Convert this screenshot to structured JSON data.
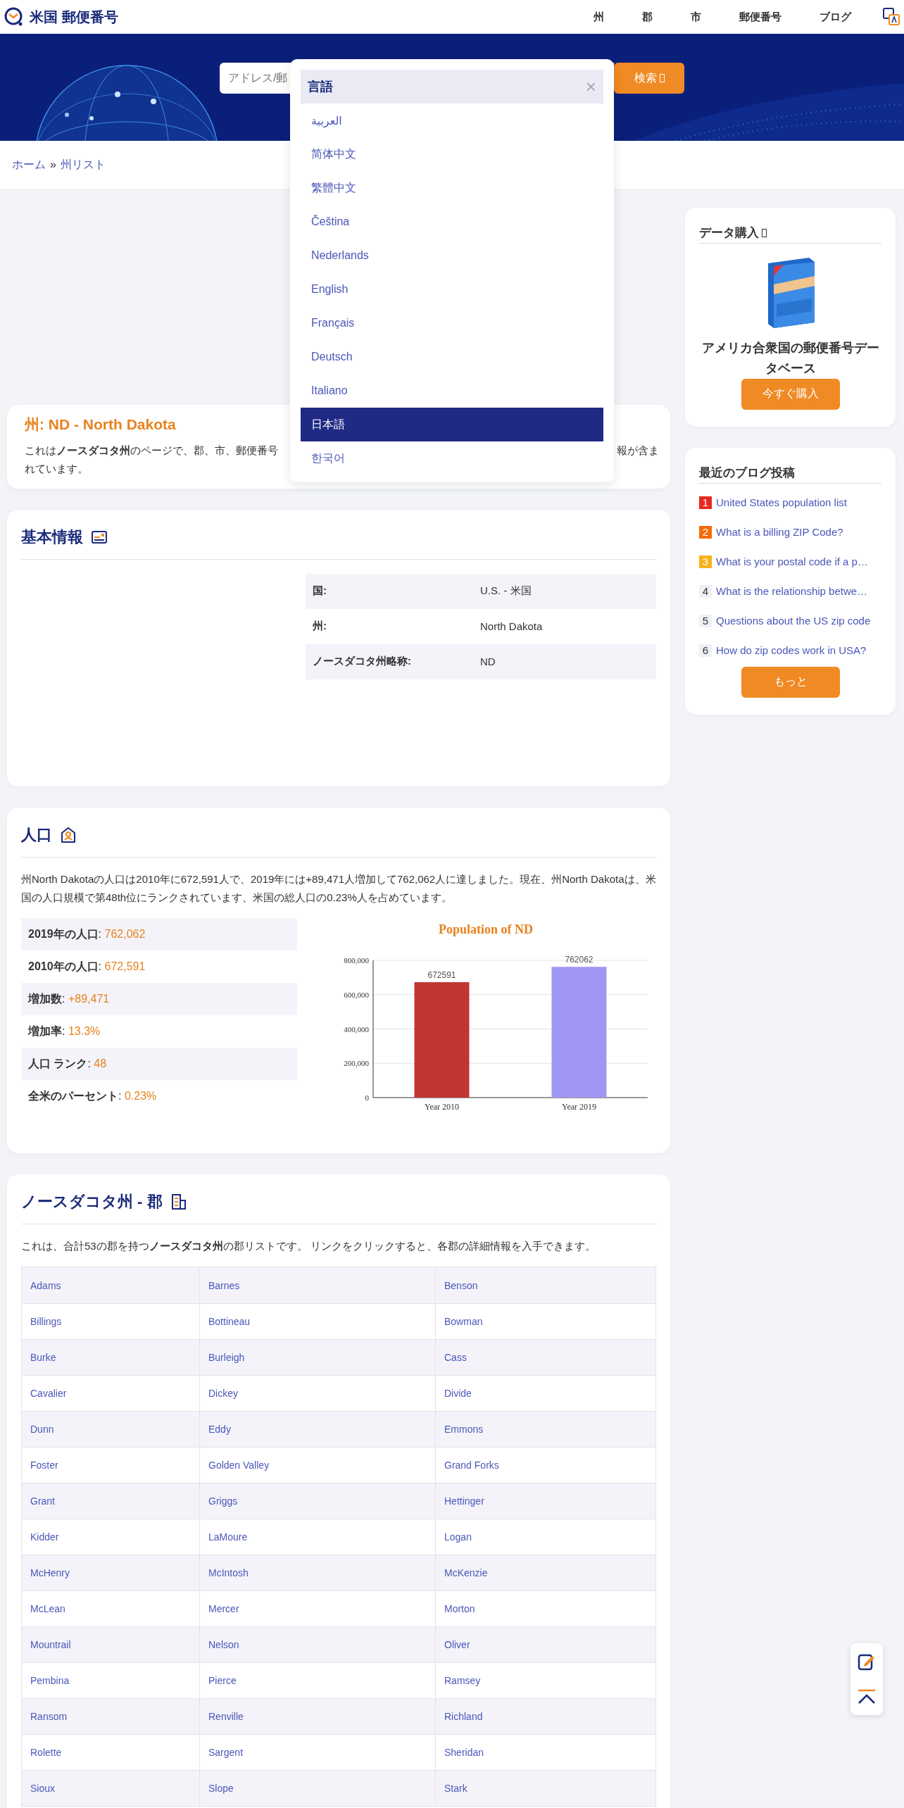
{
  "header": {
    "logo": "米国 郵便番号",
    "nav": [
      "州",
      "郡",
      "市",
      "郵便番号",
      "ブログ"
    ]
  },
  "search": {
    "placeholder": "アドレス/郵",
    "button": "検索"
  },
  "language_menu": {
    "title": "言語",
    "close": "×",
    "items": [
      {
        "label": "العربية",
        "selected": false
      },
      {
        "label": "简体中文",
        "selected": false
      },
      {
        "label": "繁體中文",
        "selected": false
      },
      {
        "label": "Čeština",
        "selected": false
      },
      {
        "label": "Nederlands",
        "selected": false
      },
      {
        "label": "English",
        "selected": false
      },
      {
        "label": "Français",
        "selected": false
      },
      {
        "label": "Deutsch",
        "selected": false
      },
      {
        "label": "Italiano",
        "selected": false
      },
      {
        "label": "日本語",
        "selected": true
      },
      {
        "label": "한국어",
        "selected": false
      }
    ]
  },
  "breadcrumb": [
    "ホーム",
    "»",
    "州リスト"
  ],
  "state_card": {
    "title": "州: ND - North Dakota",
    "intro_start": "これは**ノースダコタ州**のページで、郡、市、郵便番号",
    "intro_end_1": "報が含ま",
    "intro_end_2": "れています。"
  },
  "basic_info": {
    "title": "基本情報",
    "rows": [
      {
        "label": "国:",
        "value": "U.S. - 米国"
      },
      {
        "label": "州:",
        "value": "North Dakota"
      },
      {
        "label": "ノースダコタ州略称:",
        "value": "ND"
      }
    ]
  },
  "population": {
    "title": "人口",
    "text": "州North Dakotaの人口は2010年に672,591人で、2019年には+89,471人増加して762,062人に達しました。現在、州North Dakotaは、米国の人口規模で第48th位にランクされています、米国の総人口の0.23%人を占めています。",
    "stats": [
      {
        "label": "2019年の人口",
        "separator": ":",
        "value": "762,062"
      },
      {
        "label": "2010年の人口",
        "separator": ":",
        "value": "672,591"
      },
      {
        "label": "増加数",
        "separator": ":",
        "value": "+89,471"
      },
      {
        "label": "増加率",
        "separator": ":",
        "value": "13.3%"
      },
      {
        "label": "人口 ランク",
        "separator": ":",
        "value": "48"
      },
      {
        "label": "全米のパーセント",
        "separator": ":",
        "value": "0.23%"
      }
    ],
    "chart_data": {
      "type": "bar",
      "title": "Population of ND",
      "categories": [
        "Year 2010",
        "Year 2019"
      ],
      "series": [
        {
          "color": "#c23531",
          "values": [
            672591,
            null
          ]
        },
        {
          "color": "#a097f5",
          "values": [
            null,
            762062
          ]
        }
      ],
      "grid": true,
      "ylim": [
        0,
        800000
      ],
      "yticks": [
        {
          "value": 0,
          "label": "0"
        },
        {
          "value": 200000,
          "label": "200,000"
        },
        {
          "value": 400000,
          "label": "400,000"
        },
        {
          "value": 600000,
          "label": "600,000"
        },
        {
          "value": 800000,
          "label": "800,000"
        }
      ],
      "data_labels": true
    }
  },
  "counties": {
    "title": "ノースダコタ州 - 郡",
    "text": "これは、合計53の郡を持つ**ノースダコタ州**の郡リストです。 リンクをクリックすると、各郡の詳細情報を入手できます。",
    "rows": [
      [
        "Adams",
        "Barnes",
        "Benson"
      ],
      [
        "Billings",
        "Bottineau",
        "Bowman"
      ],
      [
        "Burke",
        "Burleigh",
        "Cass"
      ],
      [
        "Cavalier",
        "Dickey",
        "Divide"
      ],
      [
        "Dunn",
        "Eddy",
        "Emmons"
      ],
      [
        "Foster",
        "Golden Valley",
        "Grand Forks"
      ],
      [
        "Grant",
        "Griggs",
        "Hettinger"
      ],
      [
        "Kidder",
        "LaMoure",
        "Logan"
      ],
      [
        "McHenry",
        "McIntosh",
        "McKenzie"
      ],
      [
        "McLean",
        "Mercer",
        "Morton"
      ],
      [
        "Mountrail",
        "Nelson",
        "Oliver"
      ],
      [
        "Pembina",
        "Pierce",
        "Ramsey"
      ],
      [
        "Ransom",
        "Renville",
        "Richland"
      ],
      [
        "Rolette",
        "Sargent",
        "Sheridan"
      ],
      [
        "Sioux",
        "Slope",
        "Stark"
      ]
    ]
  },
  "data_purchase": {
    "title": "データ購入",
    "product": "アメリカ合衆国の郵便番号データベース",
    "button": "今すぐ購入"
  },
  "blog": {
    "title": "最近のブログ投稿",
    "posts": [
      {
        "number": "1",
        "title": "United States population list",
        "color": "#e8281f"
      },
      {
        "number": "2",
        "title": "What is a billing ZIP Code?",
        "color": "#f56b0a"
      },
      {
        "number": "3",
        "title": "What is your postal code if a p…",
        "color": "#f7b21a"
      },
      {
        "number": "4",
        "title": "What is the relationship betwe…",
        "color": "#eef0f6"
      },
      {
        "number": "5",
        "title": "Questions about the US zip code",
        "color": "#eef0f6"
      },
      {
        "number": "6",
        "title": "How do zip codes work in USA?",
        "color": "#eef0f6"
      }
    ],
    "button": "もっと"
  }
}
